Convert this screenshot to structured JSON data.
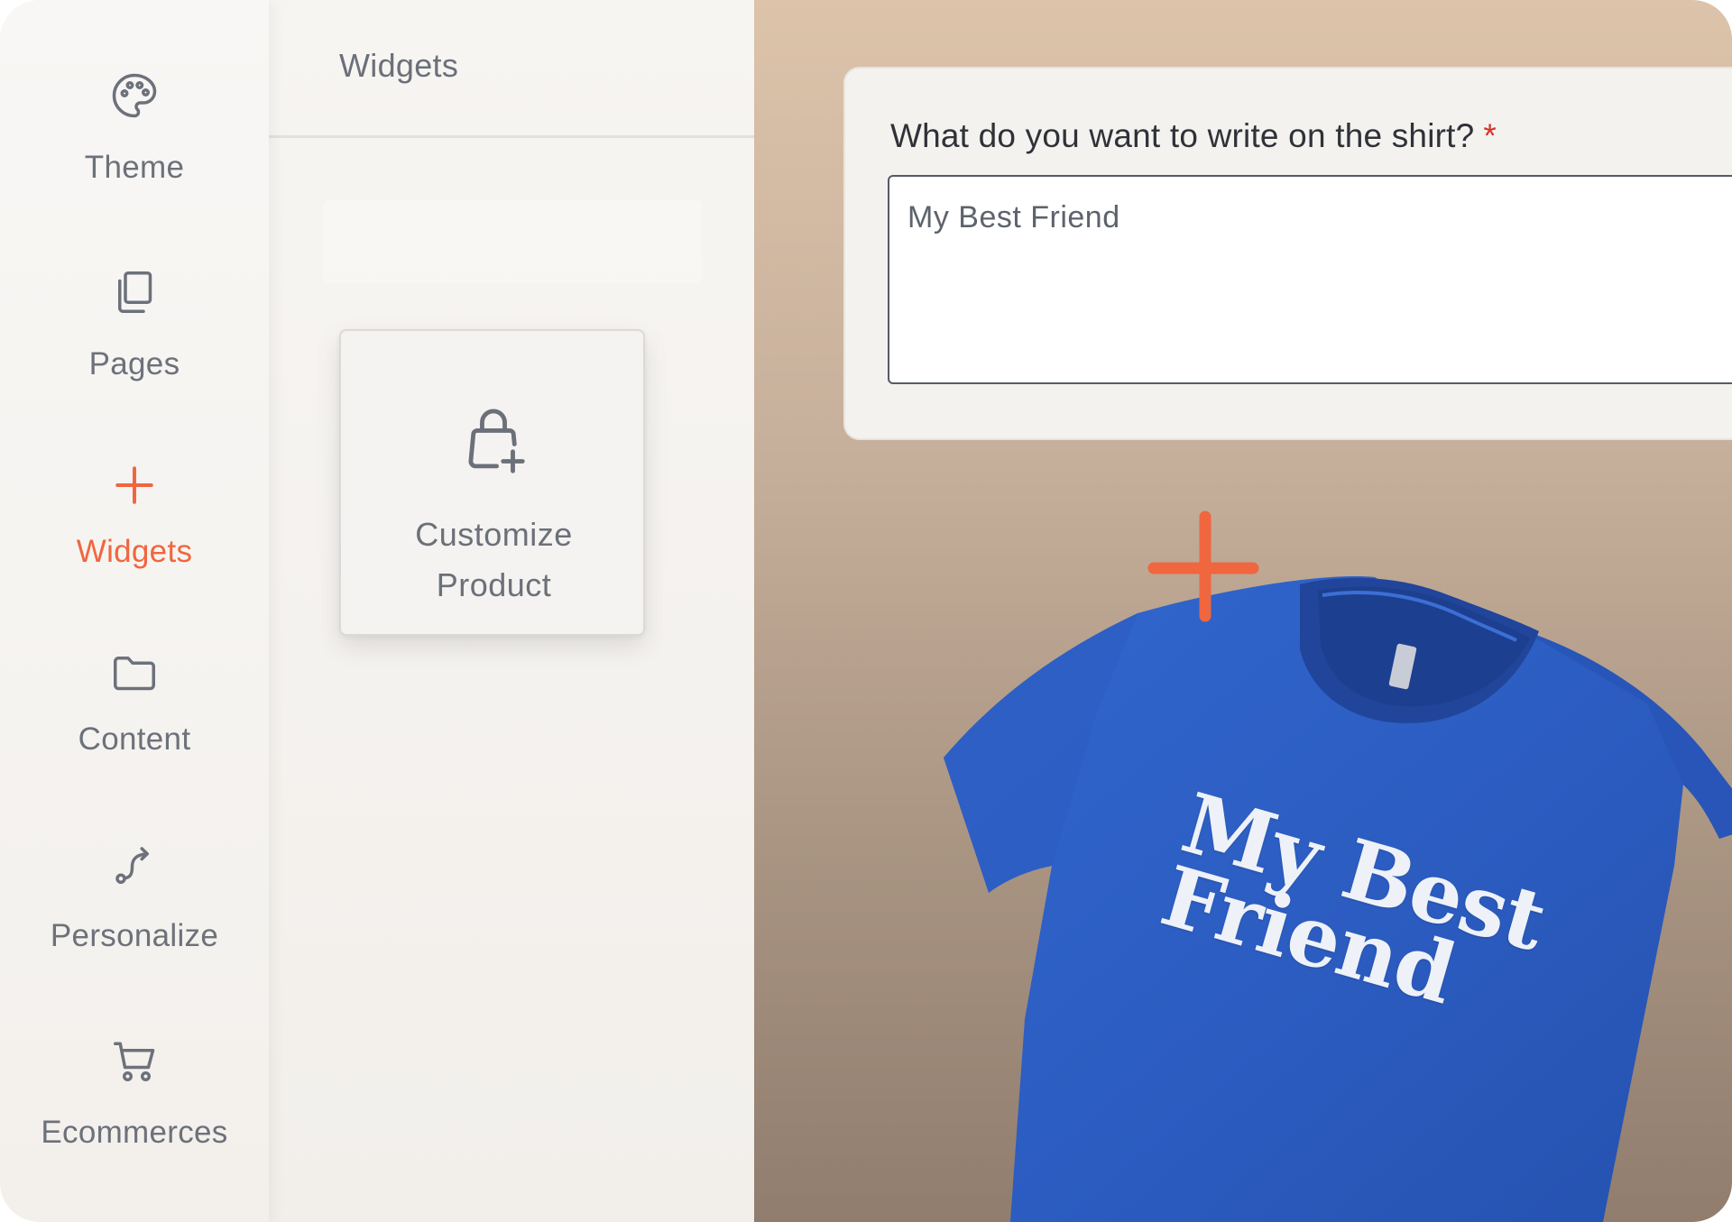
{
  "sidebar": {
    "items": [
      {
        "label": "Theme",
        "icon": "palette-icon",
        "active": false
      },
      {
        "label": "Pages",
        "icon": "pages-icon",
        "active": false
      },
      {
        "label": "Widgets",
        "icon": "plus-icon",
        "active": true
      },
      {
        "label": "Content",
        "icon": "folder-icon",
        "active": false
      },
      {
        "label": "Personalize",
        "icon": "route-icon",
        "active": false
      },
      {
        "label": "Ecommerces",
        "icon": "cart-icon",
        "active": false
      }
    ]
  },
  "panel": {
    "title": "Widgets",
    "widget": {
      "icon": "shopping-bag-plus-icon",
      "label_line1": "Customize",
      "label_line2": "Product"
    }
  },
  "preview": {
    "question": "What do you want to write on the shirt?",
    "required_mark": "*",
    "answer_value": "My Best Friend",
    "shirt_text_line1": "My Best",
    "shirt_text_line2": "Friend",
    "shirt_color": "#2d5cc0"
  },
  "colors": {
    "accent": "#f0663f",
    "muted_text": "#6b7079",
    "required": "#d0342c"
  }
}
